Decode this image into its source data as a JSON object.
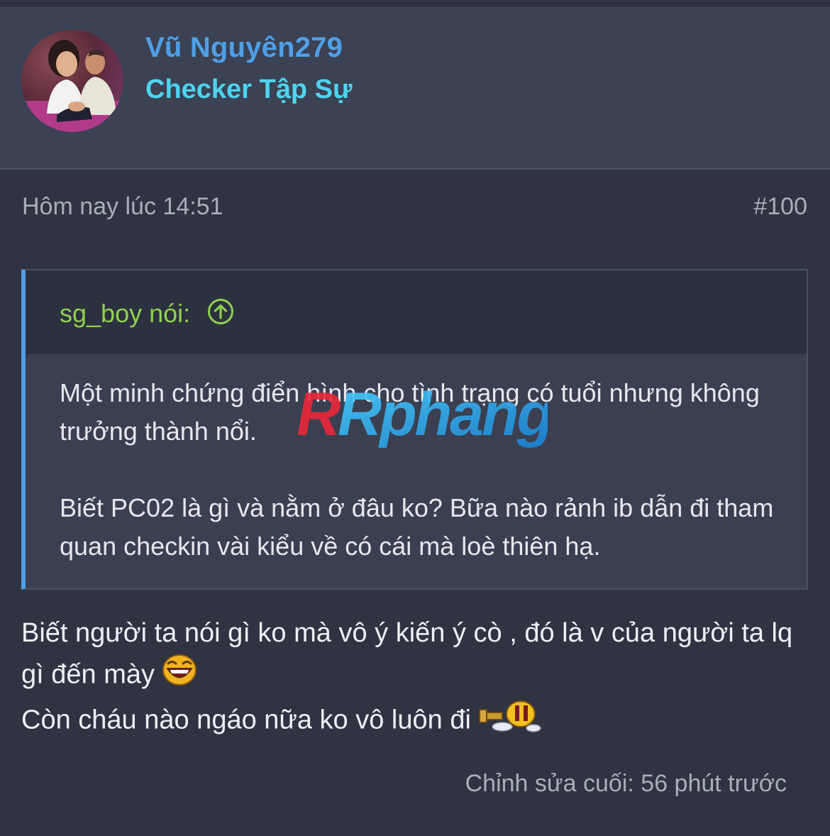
{
  "user": {
    "name": "Vũ Nguyên279",
    "title": "Checker Tập Sự"
  },
  "post": {
    "date": "Hôm nay lúc 14:51",
    "number": "#100",
    "quote": {
      "author": "sg_boy nói:",
      "jump_icon": "arrow-up-circle-icon",
      "paragraphs": [
        "Một minh chứng điển hình cho tình trạng có tuổi nhưng không trưởng thành nổi.",
        "Biết PC02 là gì và nằm ở đâu ko? Bữa nào rảnh ib dẫn đi tham quan checkin vài kiểu về có cái mà loè thiên hạ."
      ]
    },
    "reply_lines": [
      "Biết người ta nói gì ko mà vô ý kiến ý cò , đó là v của người ta lq gì đến mày",
      "Còn cháu nào ngáo nữa ko vô luôn đi"
    ],
    "edit_note": "Chỉnh sửa cuối: 56 phút trước"
  },
  "watermark": "Rphang",
  "colors": {
    "background": "#2f3342",
    "header_bg": "#3b4253",
    "username": "#4f9fe6",
    "user_title": "#4dd4f0",
    "quote_author": "#8fd14f",
    "quote_border": "#4f9fe6",
    "muted_text": "#a9aebb"
  }
}
